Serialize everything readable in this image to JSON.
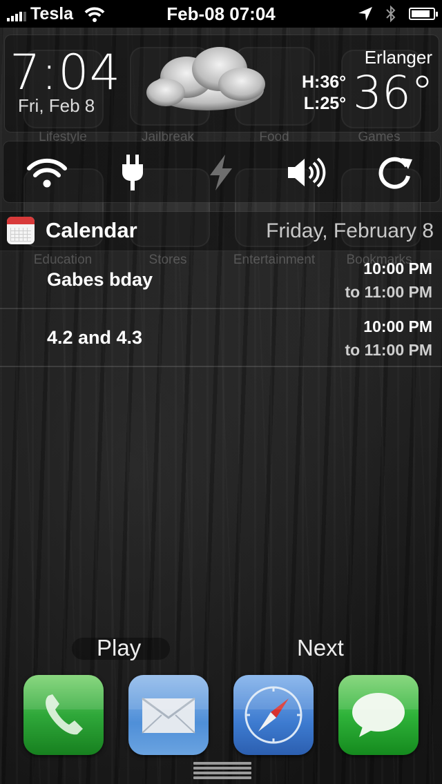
{
  "status_bar": {
    "carrier": "Tesla",
    "datetime": "Feb-08  07:04",
    "battery_level": 0.85
  },
  "springboard_ghost": {
    "folders": [
      "Lifestyle",
      "Jailbreak",
      "Food",
      "Games",
      "Education",
      "Stores",
      "Entertainment",
      "Bookmarks"
    ]
  },
  "widget": {
    "time": "7:04",
    "date": "Fri, Feb 8",
    "weather": {
      "city": "Erlanger",
      "high": "H:36°",
      "low": "L:25°",
      "temp": "36°",
      "condition_icon": "cloud-icon"
    }
  },
  "toggles": [
    {
      "name": "wifi",
      "icon": "wifi-icon",
      "on": true
    },
    {
      "name": "power",
      "icon": "plug-icon",
      "on": true
    },
    {
      "name": "flash",
      "icon": "lightning-icon",
      "on": false
    },
    {
      "name": "sound",
      "icon": "speaker-icon",
      "on": true
    },
    {
      "name": "rotation",
      "icon": "rotate-icon",
      "on": true
    }
  ],
  "calendar": {
    "title": "Calendar",
    "date": "Friday, February 8",
    "events": [
      {
        "name": "Gabes bday",
        "start": "10:00 PM",
        "end": "to 11:00 PM"
      },
      {
        "name": "4.2 and 4.3",
        "start": "10:00 PM",
        "end": "to 11:00 PM"
      }
    ]
  },
  "media": {
    "play_label": "Play",
    "next_label": "Next"
  },
  "dock": [
    {
      "name": "Phone",
      "icon": "phone-icon",
      "color": "#2fa83a"
    },
    {
      "name": "Mail",
      "icon": "mail-icon",
      "color": "#4f8fd8"
    },
    {
      "name": "Safari",
      "icon": "compass-icon",
      "color": "#3d7bd0"
    },
    {
      "name": "Messages",
      "icon": "speech-bubble-icon",
      "color": "#2fb33a"
    }
  ]
}
